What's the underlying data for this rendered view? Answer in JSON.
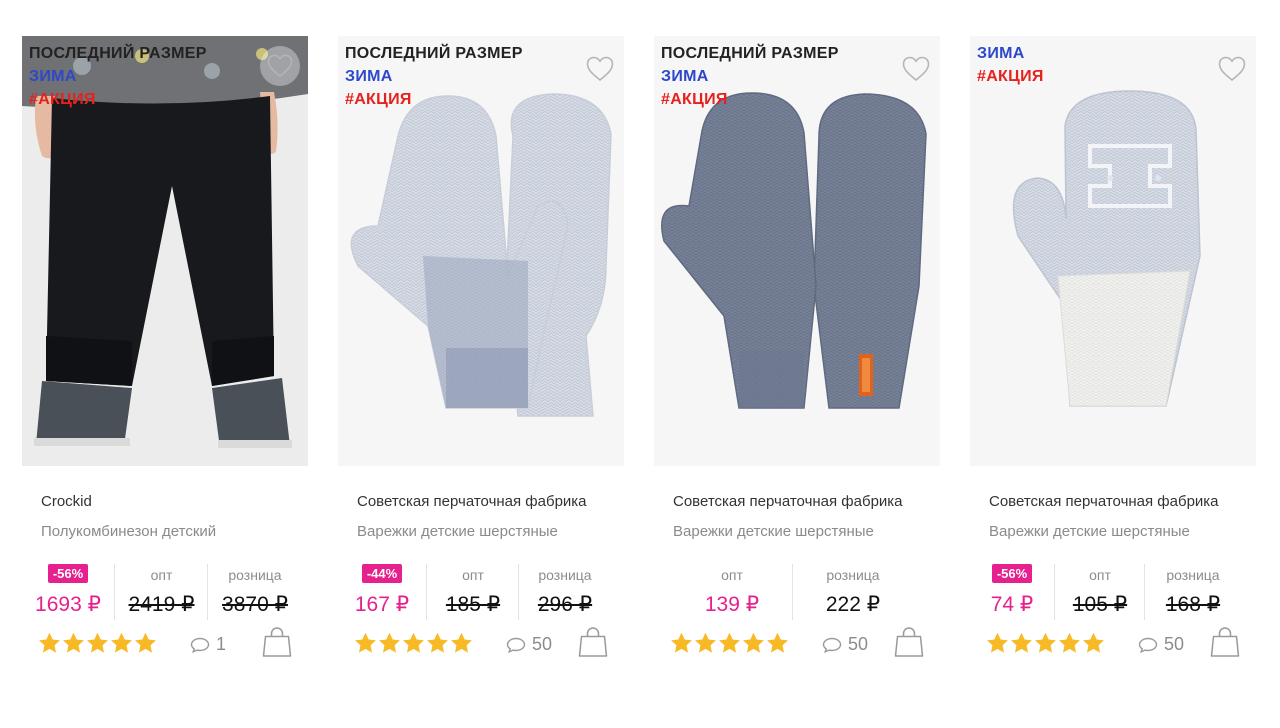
{
  "products": [
    {
      "tags": [
        "ПОСЛЕДНИЙ РАЗМЕР",
        "ЗИМА",
        "#АКЦИЯ"
      ],
      "brand": "Crockid",
      "name": "Полукомбинезон детский",
      "discount": "-56%",
      "sale_price": "1693 ₽",
      "opt_label": "опт",
      "opt_price": "2419 ₽",
      "retail_label": "розница",
      "retail_price": "3870 ₽",
      "rating": 5,
      "reviews": "1"
    },
    {
      "tags": [
        "ПОСЛЕДНИЙ РАЗМЕР",
        "ЗИМА",
        "#АКЦИЯ"
      ],
      "brand": "Советская перчаточная фабрика",
      "name": "Варежки детские шерстяные",
      "discount": "-44%",
      "sale_price": "167 ₽",
      "opt_label": "опт",
      "opt_price": "185 ₽",
      "retail_label": "розница",
      "retail_price": "296 ₽",
      "rating": 5,
      "reviews": "50"
    },
    {
      "tags": [
        "ПОСЛЕДНИЙ РАЗМЕР",
        "ЗИМА",
        "#АКЦИЯ"
      ],
      "brand": "Советская перчаточная фабрика",
      "name": "Варежки детские шерстяные",
      "opt_label": "опт",
      "opt_price": "139 ₽",
      "retail_label": "розница",
      "retail_price": "222 ₽",
      "rating": 5,
      "reviews": "50"
    },
    {
      "tags": [
        "ЗИМА",
        "#АКЦИЯ"
      ],
      "brand": "Советская перчаточная фабрика",
      "name": "Варежки детские шерстяные",
      "discount": "-56%",
      "sale_price": "74 ₽",
      "opt_label": "опт",
      "opt_price": "105 ₽",
      "retail_label": "розница",
      "retail_price": "168 ₽",
      "rating": 5,
      "reviews": "50"
    }
  ],
  "colors": {
    "accent_pink": "#e6218e",
    "tag_winter": "#2d48c8",
    "tag_promo": "#e5221e",
    "star": "#f7b924"
  },
  "icons": [
    "heart-icon",
    "star-icon",
    "comment-icon",
    "shopping-bag-icon"
  ]
}
